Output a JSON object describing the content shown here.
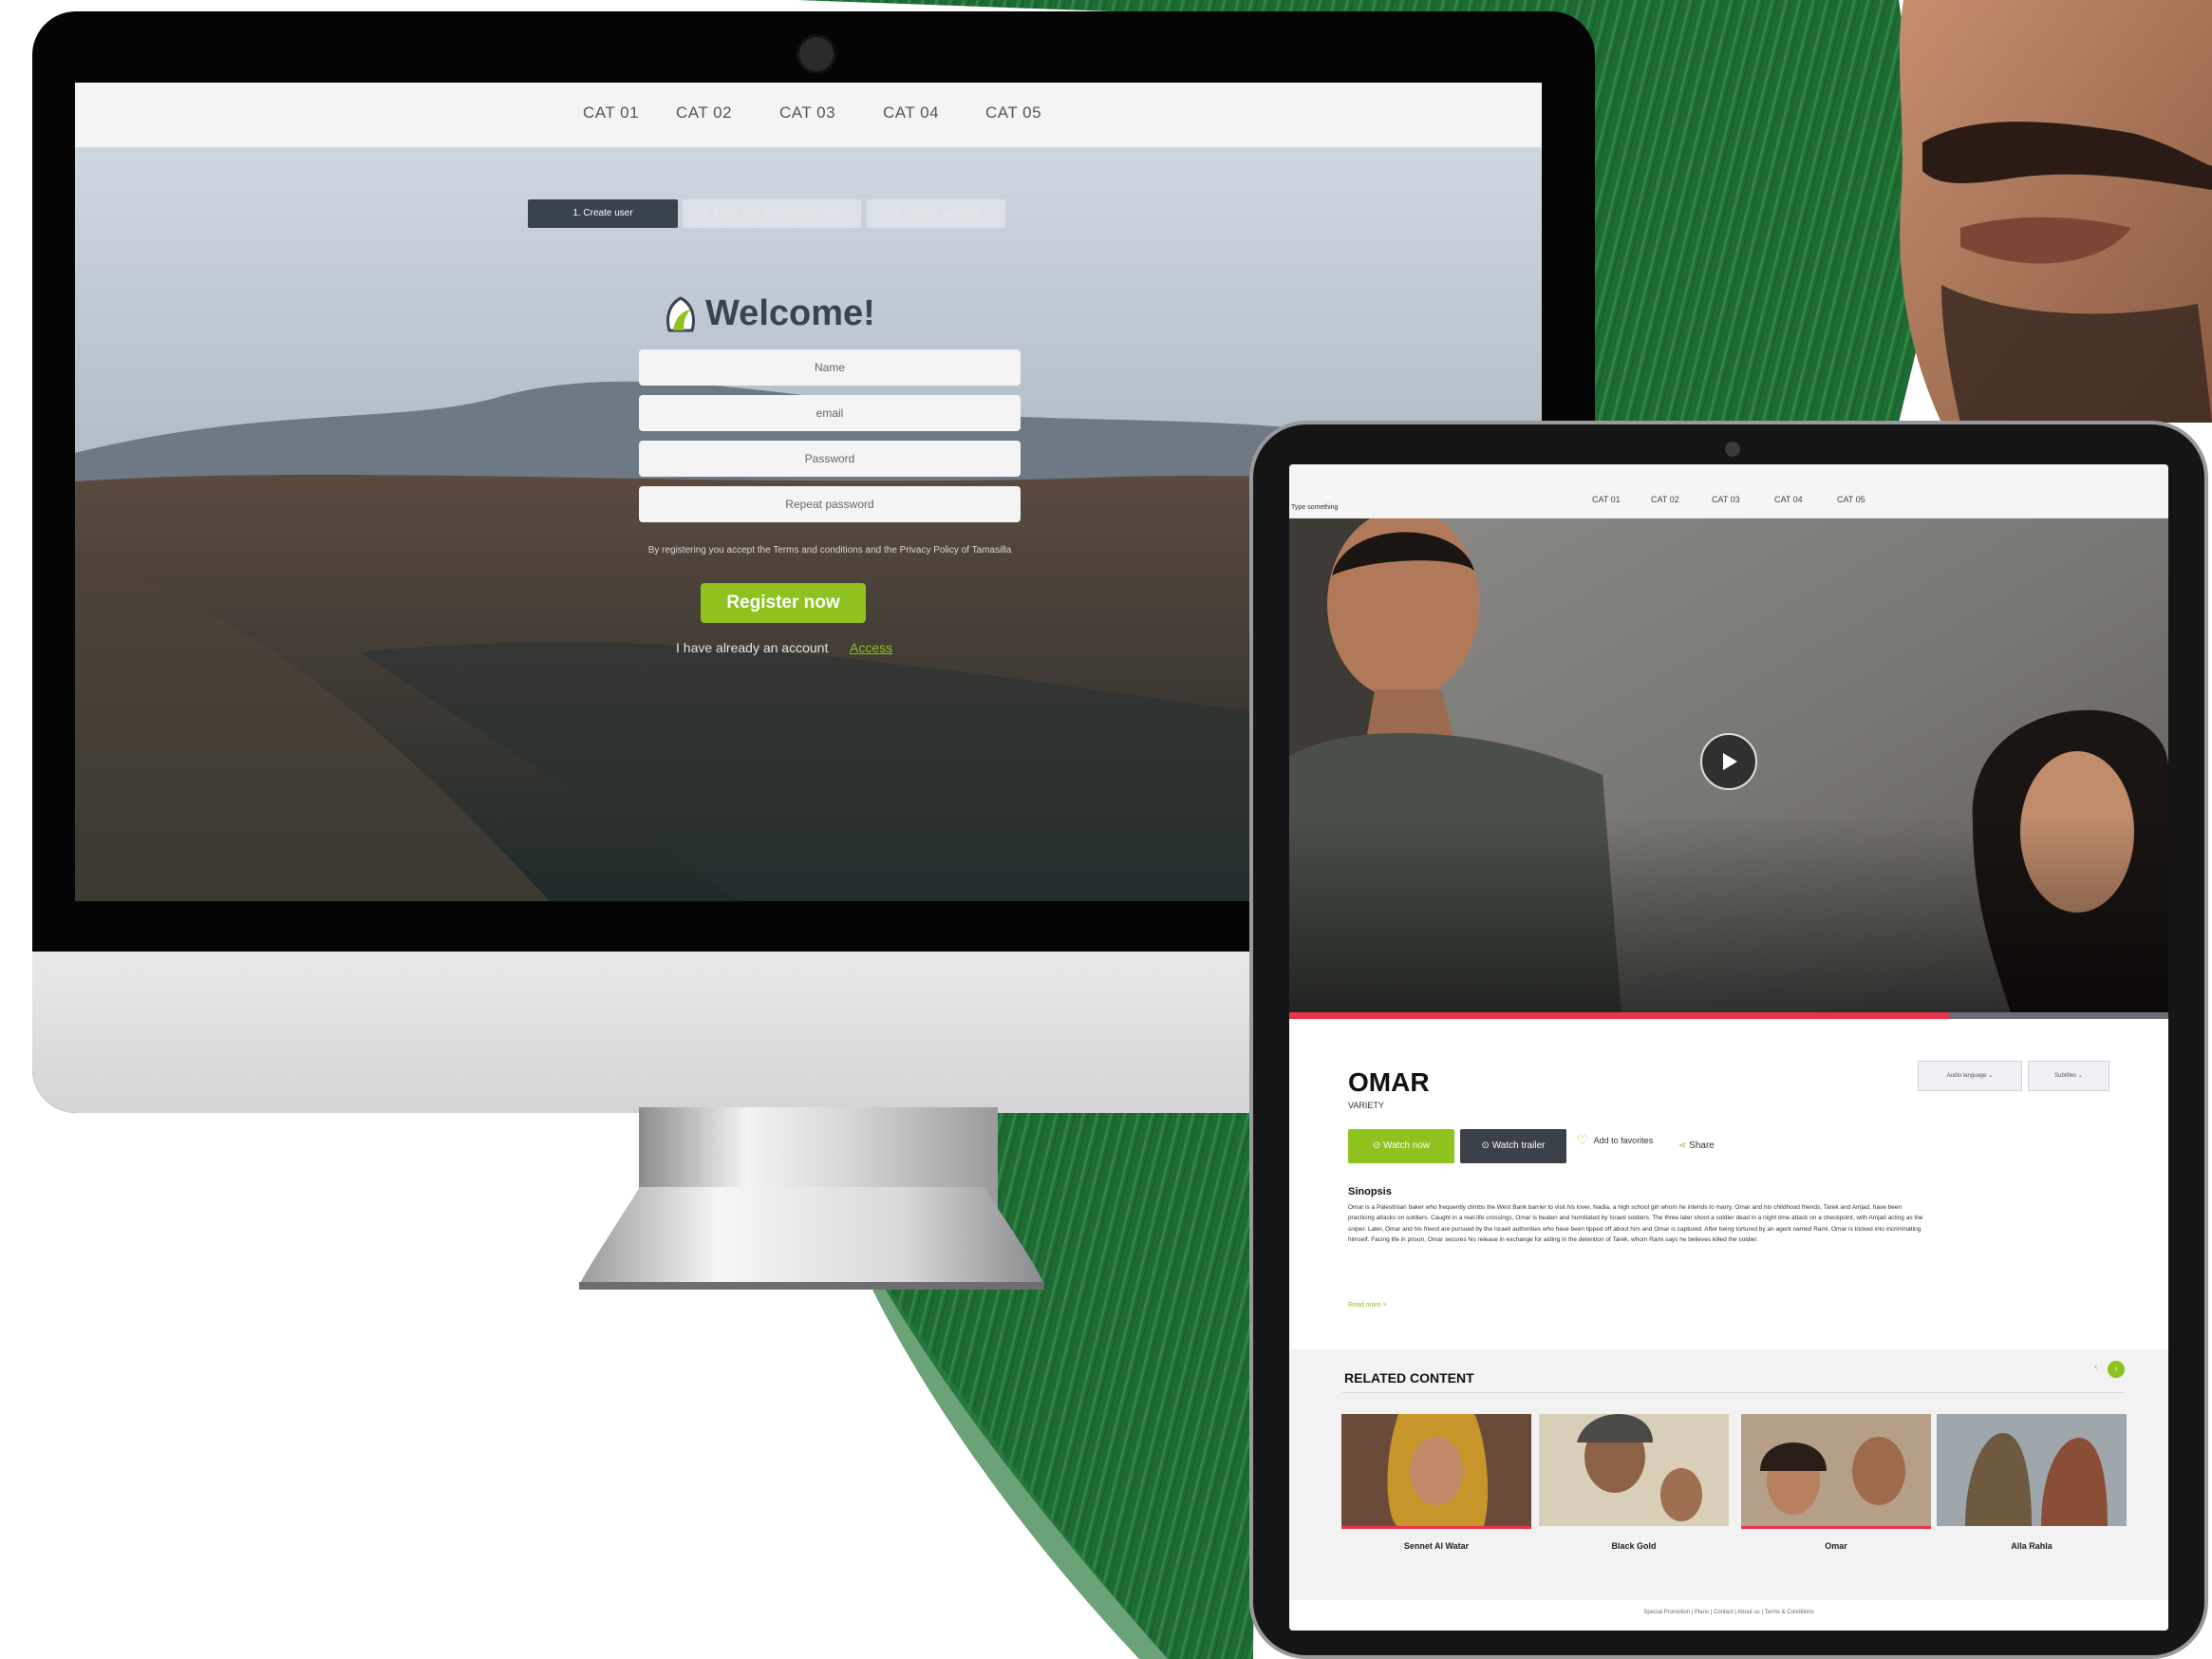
{
  "desktop": {
    "nav": [
      "CAT 01",
      "CAT 02",
      "CAT 03",
      "CAT 04",
      "CAT 05"
    ],
    "steps": [
      "1. Create user",
      "2. Select plan (promotional code)",
      "3. Confirm payment"
    ],
    "title": "Welcome!",
    "fields": [
      "Name",
      "email",
      "Password",
      "Repeat password"
    ],
    "terms": "By registering you accept the Terms and conditions and the Privacy Policy of Tamasilla",
    "register_label": "Register now",
    "account_text": "I have already an account",
    "access_label": "Access"
  },
  "tablet": {
    "search_placeholder": "Type something",
    "nav": [
      "CAT 01",
      "CAT 02",
      "CAT 03",
      "CAT 04",
      "CAT 05"
    ],
    "movie_title": "OMAR",
    "genre": "VARIETY",
    "watch_label": "Watch now",
    "trailer_label": "Watch trailer",
    "favorites_label": "Add to favorites",
    "share_label": "Share",
    "audio_select": "Audio language",
    "subtitles_select": "Subtitles",
    "synopsis_title": "Sinopsis",
    "synopsis": "Omar is a Palestinian baker who frequently climbs the West Bank barrier to visit his lover, Nadia, a high school girl whom he intends to marry. Omar and his childhood friends, Tarek and Amjad, have been practicing attacks on soldiers. Caught in a real-life crossings, Omar is beaten and humiliated by Israeli soldiers. The three later shoot a soldier dead in a night time attack on a checkpoint, with Amjad acting as the sniper. Later, Omar and his friend are pursued by the Israeli authorities who have been tipped off about him and Omar is captured. After being tortured by an agent named Rami, Omar is tricked into incriminating himself. Facing life in prison, Omar secures his release in exchange for aiding in the detention of Tarek, whom Rami says he believes killed the soldier.",
    "read_more": "Read more >",
    "related_title": "RELATED CONTENT",
    "related": [
      "Sennet Al Watar",
      "Black Gold",
      "Omar",
      "Alla Rahla"
    ],
    "footer": "Special Promotion | Plans | Contact | About us | Terms & Conditions"
  },
  "colors": {
    "brand_green": "#8dc21f",
    "brush_green": "#1e6e34",
    "accent_red": "#e8334a"
  },
  "icons": [
    "tamasilla-logo-icon",
    "play-icon",
    "heart-icon",
    "share-icon",
    "chevron-down-icon",
    "chevron-left-icon",
    "chevron-right-icon"
  ]
}
